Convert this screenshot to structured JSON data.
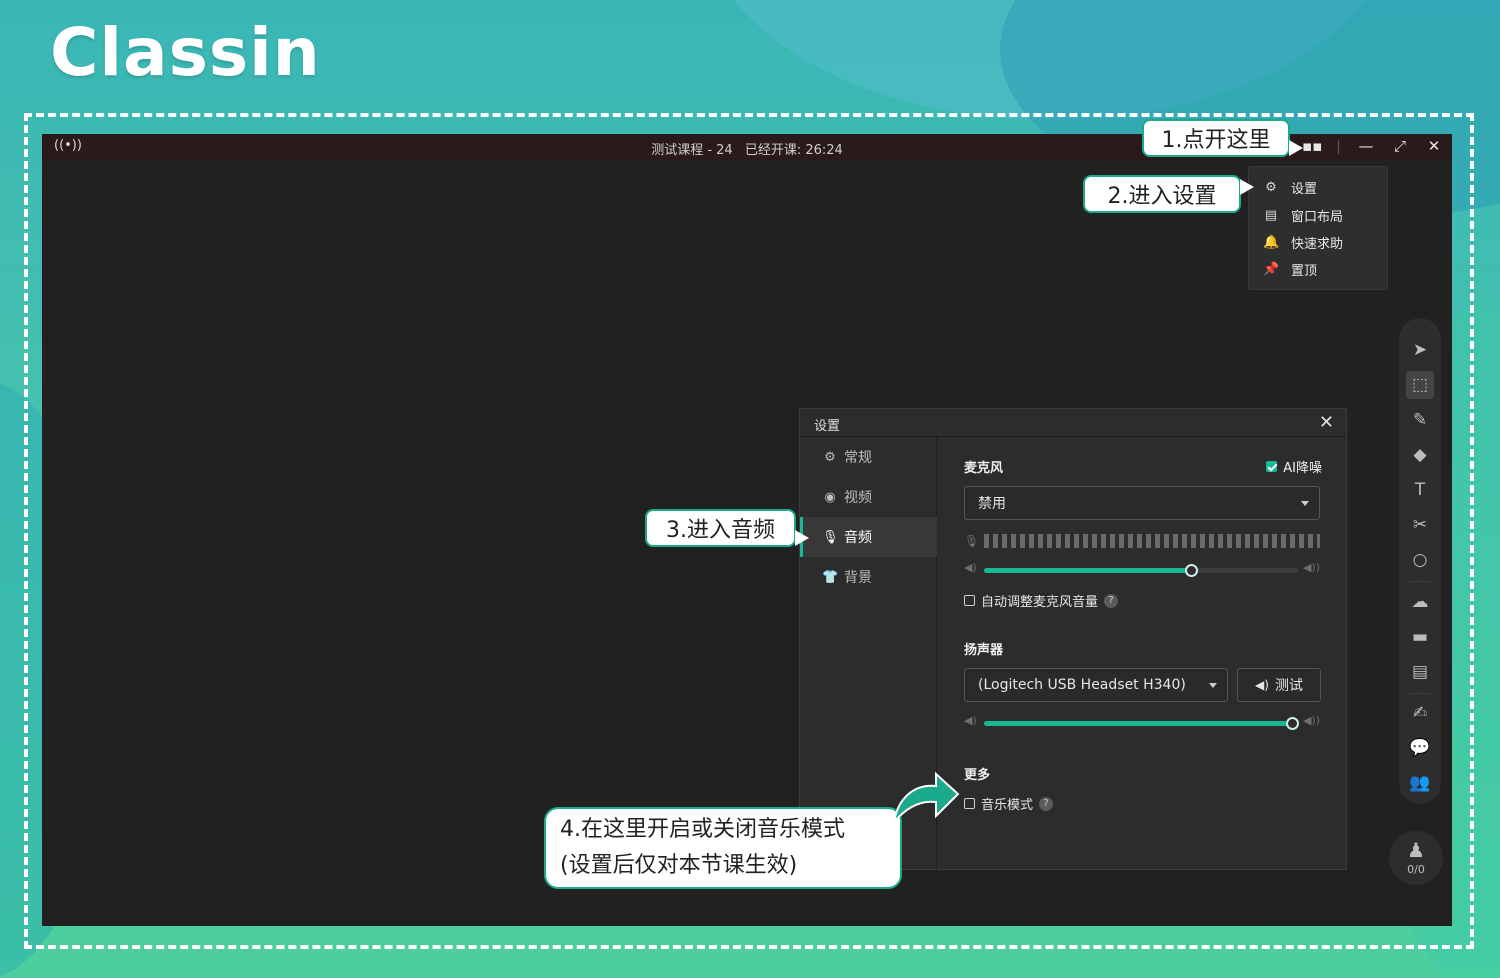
{
  "brand": {
    "logo_text": "Classin"
  },
  "titlebar": {
    "course": "测试课程 - 24",
    "elapsed": "已经开课: 26:24"
  },
  "menu": {
    "items": [
      {
        "label": "设置",
        "icon": "gear-icon"
      },
      {
        "label": "窗口布局",
        "icon": "layout-icon"
      },
      {
        "label": "快速求助",
        "icon": "bell-icon"
      },
      {
        "label": "置顶",
        "icon": "pin-icon"
      }
    ]
  },
  "settings": {
    "title": "设置",
    "nav": [
      {
        "label": "常规",
        "icon": "gear-icon"
      },
      {
        "label": "视频",
        "icon": "camera-icon"
      },
      {
        "label": "音频",
        "icon": "microphone-icon",
        "active": true
      },
      {
        "label": "背景",
        "icon": "shirt-icon"
      }
    ],
    "microphone": {
      "section_label": "麦克风",
      "ai_noise_label": "AI降噪",
      "ai_noise_checked": true,
      "device": "禁用",
      "volume_fraction": 0.66,
      "auto_adjust_label": "自动调整麦克风音量",
      "auto_adjust_checked": false
    },
    "speaker": {
      "section_label": "扬声器",
      "device": "(Logitech USB Headset H340)",
      "test_label": "测试",
      "volume_fraction": 0.98
    },
    "more": {
      "section_label": "更多",
      "music_mode_label": "音乐模式",
      "music_mode_checked": false
    },
    "help_glyph": "?"
  },
  "toolbar": {
    "tools": [
      "pointer-icon",
      "select-icon",
      "laser-pen-icon",
      "eraser-icon",
      "text-icon",
      "scissors-icon",
      "shape-icon",
      "cloud-icon",
      "toolbox-icon",
      "notes-icon",
      "edit-icon",
      "chat-icon",
      "users-icon"
    ]
  },
  "seat": {
    "count": "0/0"
  },
  "callouts": {
    "step1": "1.点开这里",
    "step2": "2.进入设置",
    "step3": "3.进入音频",
    "step4_line1": "4.在这里开启或关闭音乐模式",
    "step4_line2": "(设置后仅对本节课生效)"
  },
  "colors": {
    "accent": "#19b894",
    "app_bg": "#212121",
    "callout_border": "#1aa98b"
  }
}
